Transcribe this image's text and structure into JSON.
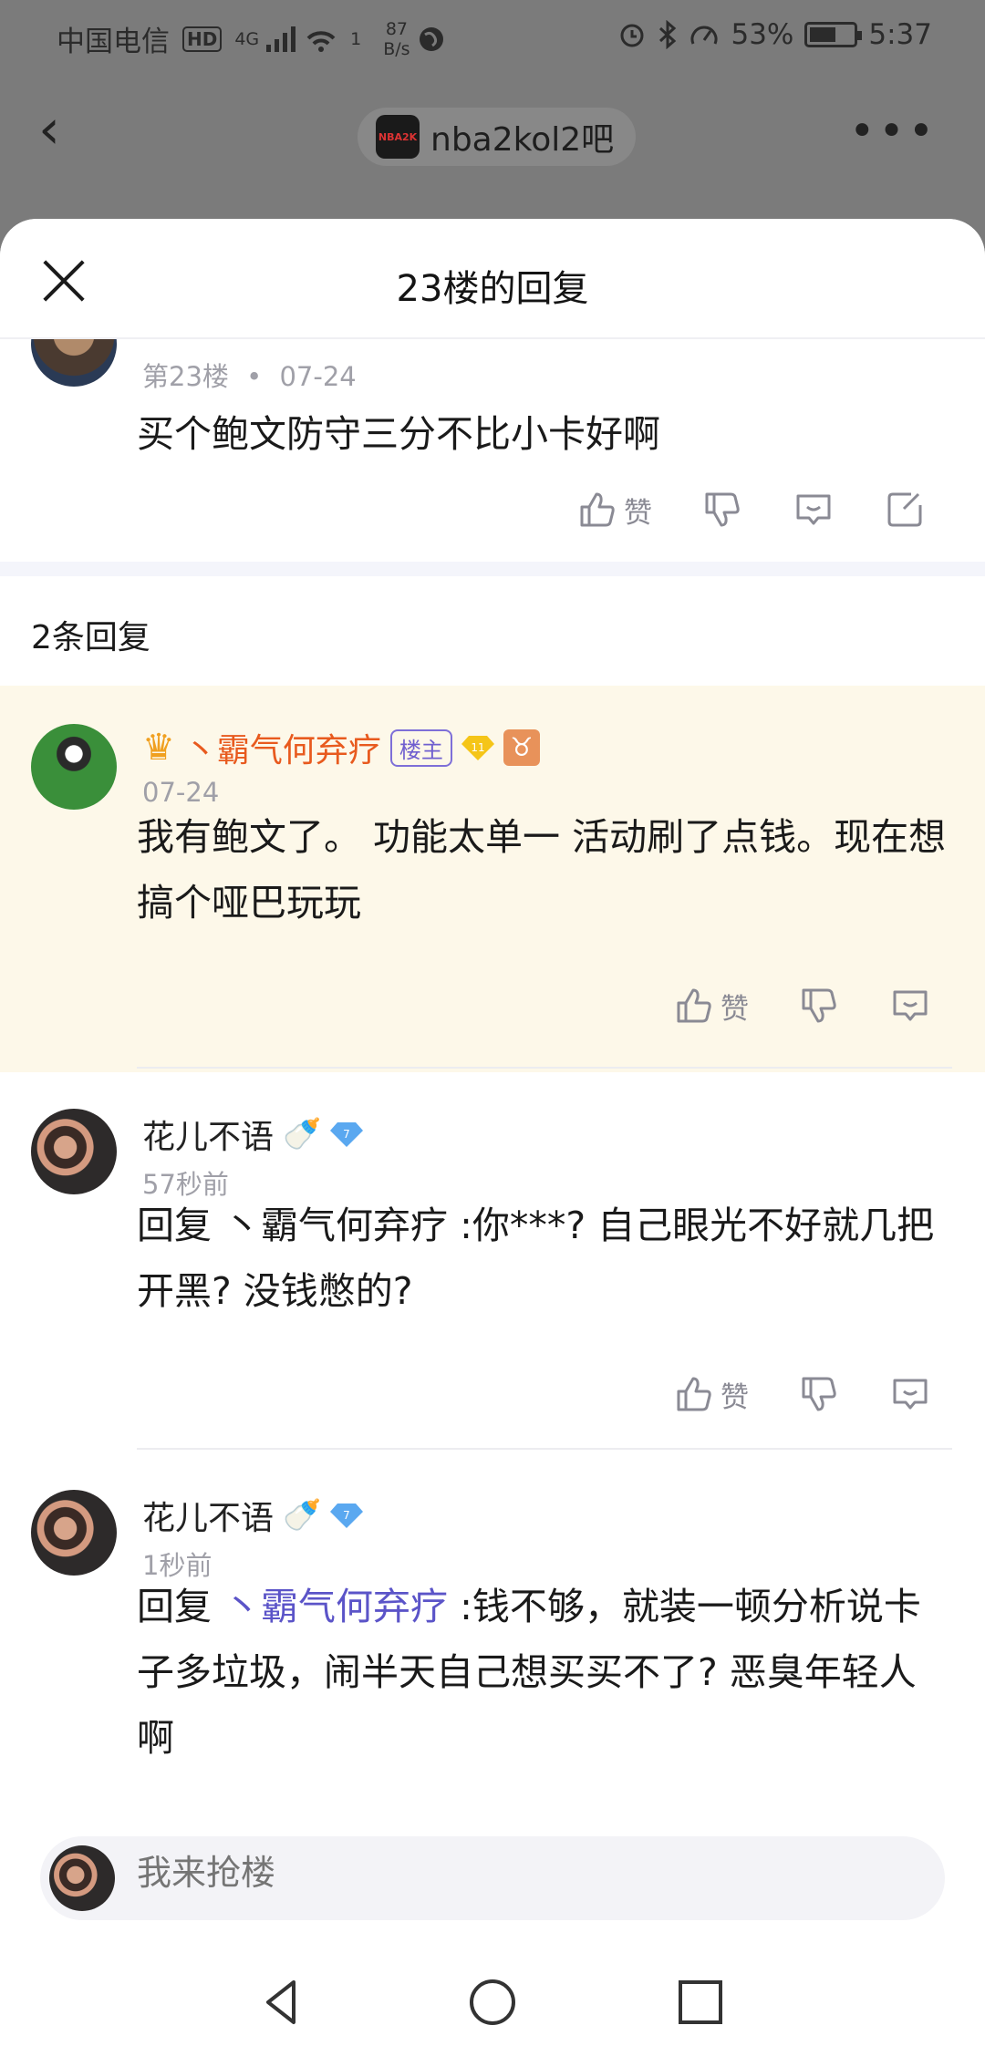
{
  "status_bar": {
    "carrier": "中国电信",
    "hd": "HD",
    "network": "4G",
    "wifi_sup": "1",
    "speed_value": "87",
    "speed_unit": "B/s",
    "battery": "53%",
    "time": "5:37"
  },
  "app_header": {
    "forum_name": "nba2kol2吧",
    "forum_logo_text": "NBA2K"
  },
  "sheet": {
    "title": "23楼的回复"
  },
  "main_post": {
    "floor": "第23楼",
    "dot": "•",
    "date": "07-24",
    "text": "买个鲍文防守三分不比小卡好啊",
    "like_label": "赞"
  },
  "reply_count": "2条回复",
  "replies": [
    {
      "username": "丶霸气何弃疗",
      "owner_tag": "楼主",
      "level": "11",
      "zodiac": "♉",
      "time": "07-24",
      "text": "我有鲍文了。 功能太单一 活动刷了点钱。现在想搞个哑巴玩玩",
      "like_label": "赞"
    },
    {
      "username": "花儿不语",
      "emoji": "🍼",
      "level": "7",
      "time": "57秒前",
      "text": "回复 丶霸气何弃疗 :你***? 自己眼光不好就几把开黑? 没钱憋的?",
      "like_label": "赞"
    },
    {
      "username": "花儿不语",
      "emoji": "🍼",
      "level": "7",
      "time": "1秒前",
      "reply_prefix": "回复 ",
      "mention": "丶霸气何弃疗",
      "text": " :钱不够，就装一顿分析说卡子多垃圾，闹半天自己想买买不了? 恶臭年轻人啊"
    }
  ],
  "composer": {
    "placeholder": "我来抢楼"
  },
  "colors": {
    "owner_name": "#e85a1e",
    "mention": "#5b54c8",
    "highlight_bg": "#fdf8e9",
    "owner_tag": "#7e6fd8"
  }
}
